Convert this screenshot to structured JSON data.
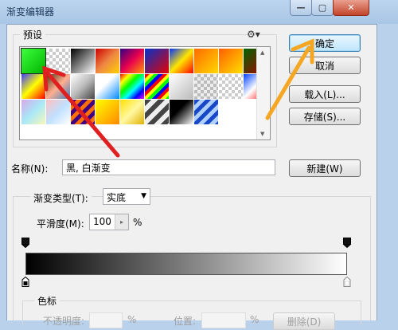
{
  "window": {
    "title": "渐变编辑器",
    "controls": {
      "minimize": "—",
      "maximize": "▢",
      "close": "✕"
    }
  },
  "presets": {
    "group_title": "预设",
    "menu_icon": "gear-icon",
    "swatches": [
      "linear-gradient(135deg,#3dff3d,#00b300)",
      "repeating-conic-gradient(#ccc 0 25%,#fff 0 50%) 0 0/8px 8px",
      "linear-gradient(135deg,#000,#fff)",
      "linear-gradient(135deg,#c00,#e84,#ffd100)",
      "linear-gradient(135deg,#320080,#e80050,#ff9a00)",
      "linear-gradient(135deg,#0033cc,#e60000)",
      "linear-gradient(135deg,#0030ff,#ffe600,#ff0000)",
      "linear-gradient(135deg,#ff6a00,#ffd800)",
      "linear-gradient(135deg,#ff5e00,#ffe000)",
      "linear-gradient(135deg,#006400,#b00000)",
      "linear-gradient(135deg,#4040ff,#ff0,#f00)",
      "linear-gradient(135deg,#503010,#ffb090,#4080c0)",
      "linear-gradient(135deg,#fff,#bbb,#444)",
      "linear-gradient(135deg,#fff 40%,#08f)",
      "linear-gradient(135deg,#f00,#ff0,#0f0,#0ff,#00f,#f0f)",
      "repeating-linear-gradient(135deg,#f00 0 4px,#ff0 4px 8px,#0f0 8px 12px,#00f 12px 16px)",
      "linear-gradient(135deg,#fff,#bbb) ",
      "repeating-conic-gradient(#bbb 0 25%,#eee 0 50%) 0 0/8px 8px",
      "repeating-conic-gradient(#ccc 0 25%,#fff 0 50%) 0 0/8px 8px",
      "linear-gradient(135deg,#0040ff,#fff,#ff0000)",
      "linear-gradient(135deg,#d8a8e8,#a8e8f8,#f8f8b8)",
      "linear-gradient(135deg,#ffc0c0,#c0e0ff,#fff)",
      "repeating-linear-gradient(135deg,#400080 0 5px,#ff7000 5px 10px)",
      "linear-gradient(135deg,#ff0,#f80)",
      "linear-gradient(135deg,#ffe000,#fff8a0,#e0b000)",
      "repeating-linear-gradient(135deg,#444 0 6px,#eee 6px 12px)",
      "linear-gradient(135deg,#000 40%,#fff)",
      "repeating-linear-gradient(135deg,#1848c8 0 5px,#b0d0ff 5px 10px)"
    ]
  },
  "buttons": {
    "ok": "确定",
    "cancel": "取消",
    "load": "载入(L)...",
    "save": "存储(S)...",
    "new": "新建(W)"
  },
  "name_field": {
    "label": "名称(N):",
    "value": "黑, 白渐变"
  },
  "gradient": {
    "type_label": "渐变类型(T):",
    "type_value": "实底",
    "smoothness_label": "平滑度(M):",
    "smoothness_value": "100",
    "smoothness_unit": "%",
    "start_color": "#000000",
    "end_color": "#ffffff"
  },
  "color_stops": {
    "group_title": "色标",
    "opacity_label": "不透明度:",
    "opacity_unit": "%",
    "location_label": "位置:",
    "location_unit": "%",
    "delete_label": "删除(D)"
  },
  "annotation_colors": {
    "red_arrow": "#e02020",
    "orange_arrow": "#f5a623"
  }
}
